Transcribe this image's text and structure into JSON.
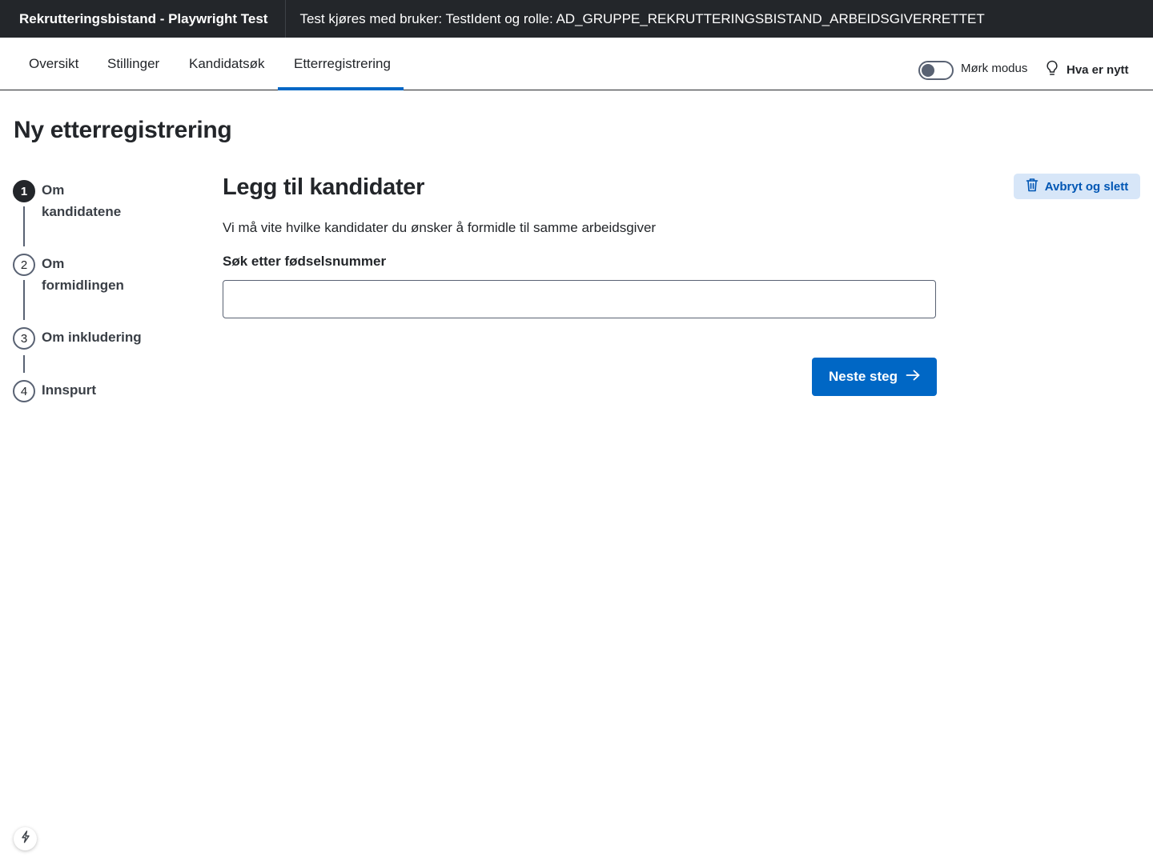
{
  "header": {
    "app_title": "Rekrutteringsbistand - Playwright Test",
    "test_info": "Test kjøres med bruker: TestIdent og rolle: AD_GRUPPE_REKRUTTERINGSBISTAND_ARBEIDSGIVERRETTET"
  },
  "nav": {
    "tabs": [
      {
        "label": "Oversikt",
        "active": false
      },
      {
        "label": "Stillinger",
        "active": false
      },
      {
        "label": "Kandidatsøk",
        "active": false
      },
      {
        "label": "Etterregistrering",
        "active": true
      }
    ],
    "dark_mode_label": "Mørk modus",
    "dark_mode_on": false,
    "whats_new_label": "Hva er nytt",
    "whats_new_icon": "lightbulb-icon"
  },
  "page": {
    "title": "Ny etterregistrering"
  },
  "stepper": {
    "steps": [
      {
        "number": "1",
        "label": "Om kandidatene",
        "active": true
      },
      {
        "number": "2",
        "label": "Om formidlingen",
        "active": false
      },
      {
        "number": "3",
        "label": "Om inkludering",
        "active": false
      },
      {
        "number": "4",
        "label": "Innspurt",
        "active": false
      }
    ]
  },
  "form": {
    "title": "Legg til kandidater",
    "description": "Vi må vite hvilke kandidater du ønsker å formidle til samme arbeidsgiver",
    "search_label": "Søk etter fødselsnummer",
    "search_value": "",
    "next_button_label": "Neste steg",
    "next_icon": "arrow-right-icon",
    "cancel_button_label": "Avbryt og slett",
    "cancel_icon": "trash-icon"
  },
  "colors": {
    "header_bg": "#23262a",
    "accent": "#0067c5",
    "secondary_bg": "#d7e6f8",
    "secondary_text": "#0056b4"
  }
}
